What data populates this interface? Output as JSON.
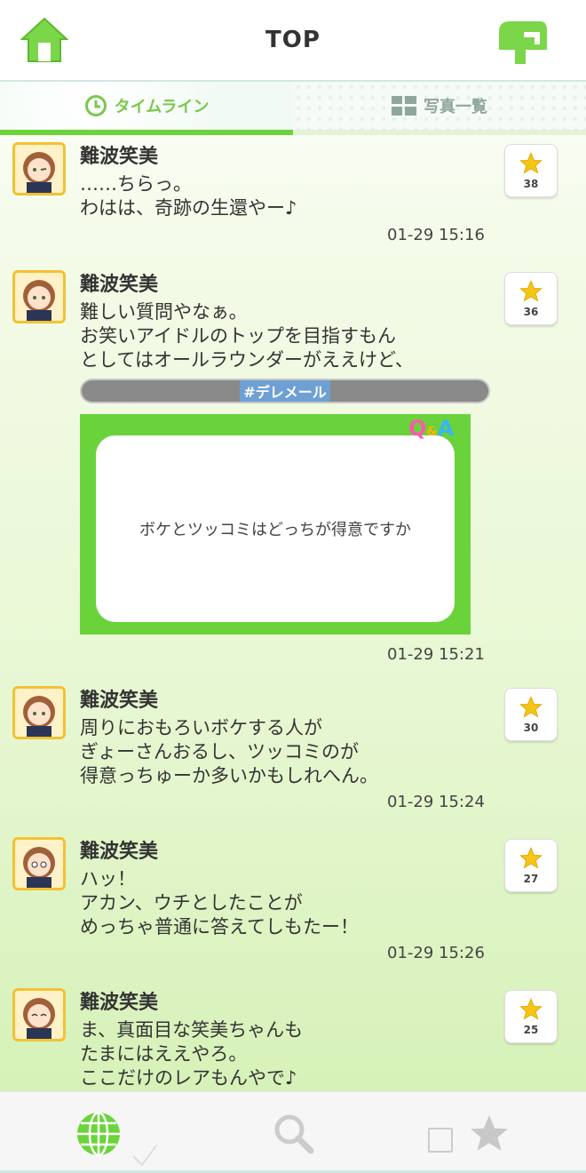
{
  "header": {
    "title": "TOP"
  },
  "tabs": [
    {
      "label": "タイムライン",
      "active": true
    },
    {
      "label": "写真一覧",
      "active": false
    }
  ],
  "posts": [
    {
      "author": "難波笑美",
      "text": "……ちらっ。\nわはは、奇跡の生還やー♪",
      "time": "01-29 15:16",
      "likes": "38"
    },
    {
      "author": "難波笑美",
      "text": "難しい質問やなぁ。\nお笑いアイドルのトップを目指すもん\nとしてはオールラウンダーがええけど、",
      "hashtag": "#デレメール",
      "qa": {
        "question": "ボケとツッコミはどっちが得意ですか",
        "logo_q": "Q",
        "logo_amp": "&",
        "logo_a": "A"
      },
      "time": "01-29 15:21",
      "likes": "36"
    },
    {
      "author": "難波笑美",
      "text": "周りにおもろいボケする人が\nぎょーさんおるし、ツッコミのが\n得意っちゅーか多いかもしれへん。",
      "time": "01-29 15:24",
      "likes": "30"
    },
    {
      "author": "難波笑美",
      "text": "ハッ！\nアカン、ウチとしたことが\nめっちゃ普通に答えてしもたー！",
      "time": "01-29 15:26",
      "likes": "27"
    },
    {
      "author": "難波笑美",
      "text": "ま、真面目な笑美ちゃんも\nたまにはええやろ。\nここだけのレアもんやで♪",
      "likes": "25"
    }
  ],
  "colors": {
    "accent": "#6bd43a",
    "star": "#f5c518",
    "hashtag_bg": "#8a8a8a"
  }
}
